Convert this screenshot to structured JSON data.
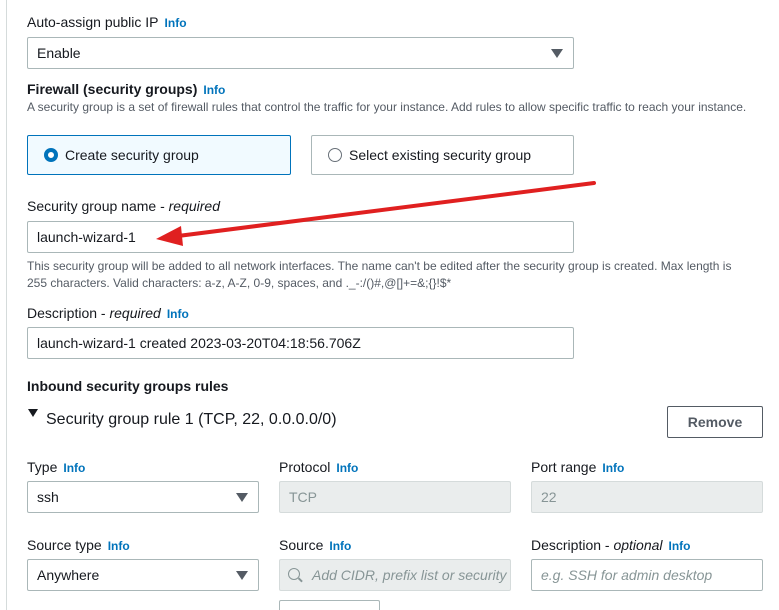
{
  "info_label": "Info",
  "auto_assign": {
    "label": "Auto-assign public IP",
    "value": "Enable"
  },
  "firewall": {
    "title": "Firewall (security groups)",
    "description": "A security group is a set of firewall rules that control the traffic for your instance. Add rules to allow specific traffic to reach your instance.",
    "option_create": "Create security group",
    "option_select": "Select existing security group",
    "selected": "create"
  },
  "sg_name": {
    "label": "Security group name - ",
    "required": "required",
    "value": "launch-wizard-1",
    "help_line1": "This security group will be added to all network interfaces. The name can't be edited after the security group is created. Max length is",
    "help_line2": "255 characters. Valid characters: a-z, A-Z, 0-9, spaces, and ._-:/()#,@[]+=&;{}!$*"
  },
  "description": {
    "label": "Description - ",
    "required": "required",
    "value": "launch-wizard-1 created 2023-03-20T04:18:56.706Z"
  },
  "inbound": {
    "title": "Inbound security groups rules",
    "rule_title": "Security group rule 1 (TCP, 22, 0.0.0.0/0)",
    "remove_label": "Remove",
    "type_label": "Type",
    "type_value": "ssh",
    "protocol_label": "Protocol",
    "protocol_value": "TCP",
    "port_label": "Port range",
    "port_value": "22",
    "source_type_label": "Source type",
    "source_type_value": "Anywhere",
    "source_label": "Source",
    "source_placeholder": "Add CIDR, prefix list or security",
    "rule_desc_label": "Description - ",
    "rule_desc_optional": "optional",
    "rule_desc_placeholder": "e.g. SSH for admin desktop"
  },
  "colors": {
    "accent": "#0073bb",
    "arrow": "#e02020"
  }
}
